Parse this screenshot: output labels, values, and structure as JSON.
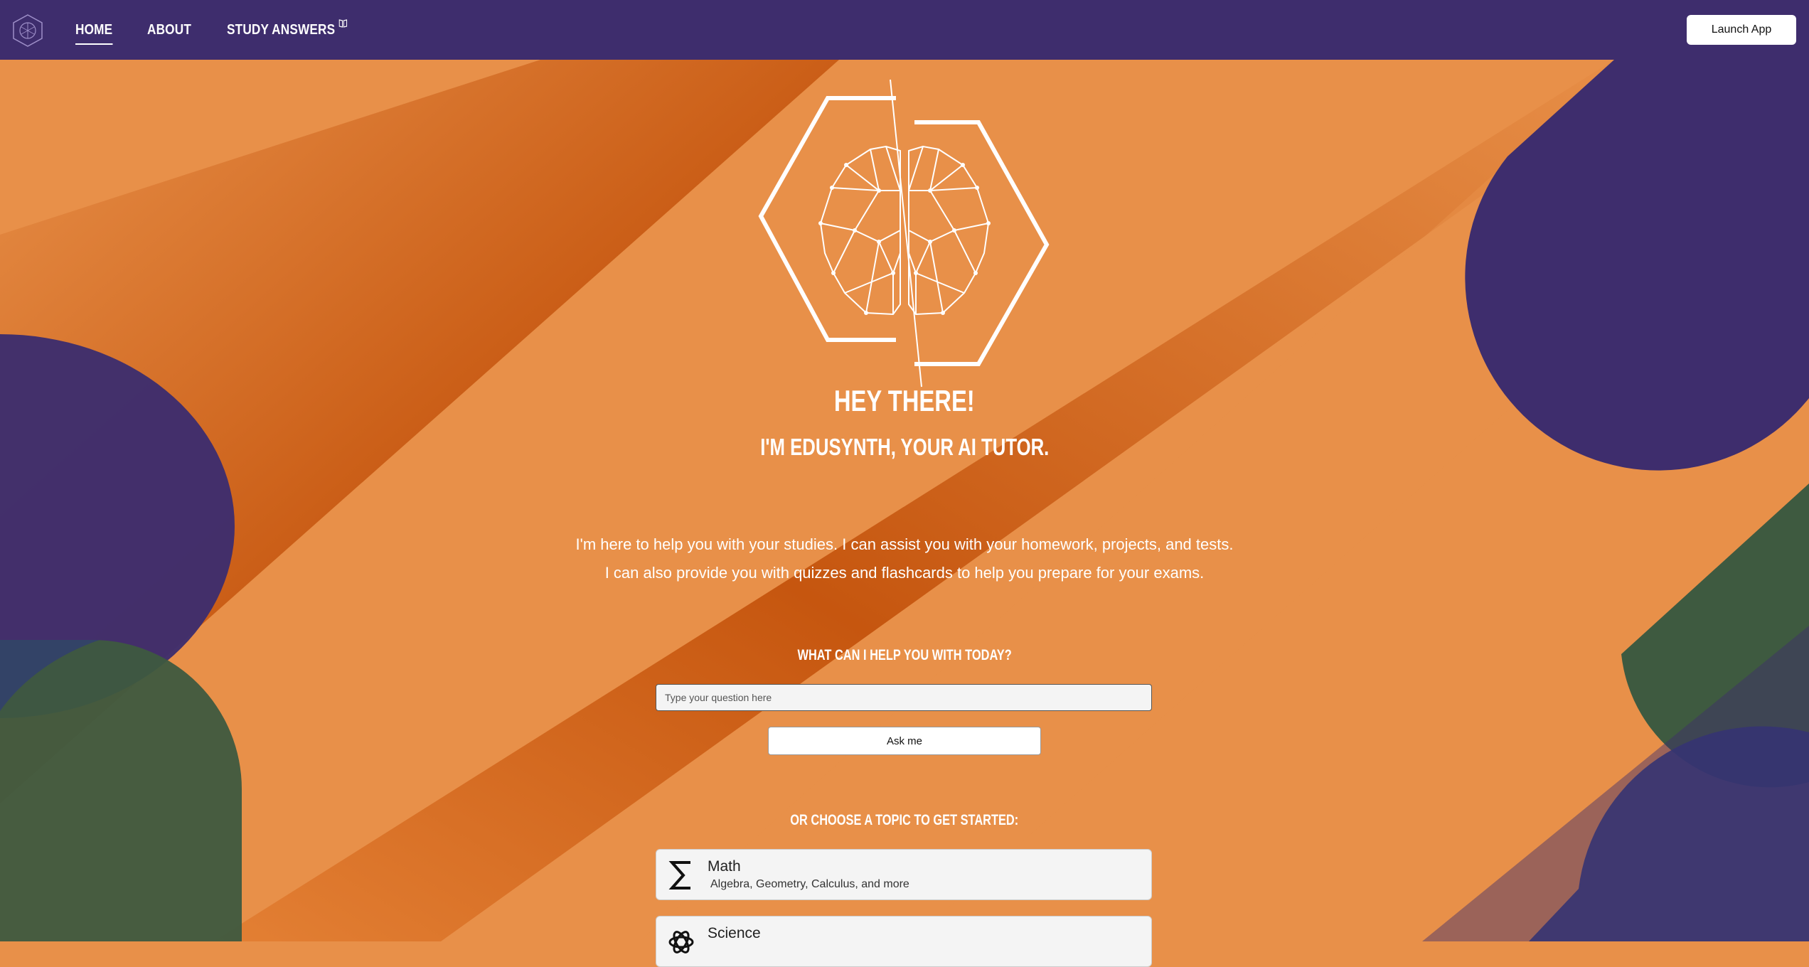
{
  "nav": {
    "links": [
      {
        "label": "Home",
        "active": true
      },
      {
        "label": "About",
        "active": false
      },
      {
        "label": "Study Answers",
        "active": false
      }
    ],
    "launch_label": "Launch App"
  },
  "hero": {
    "title": "Hey there!",
    "subtitle": "I'm EduSynth, your AI tutor.",
    "intro_line1": "I'm here to help you with your studies. I can assist you with your homework, projects, and tests.",
    "intro_line2": "I can also provide you with quizzes and flashcards to help you prepare for your exams."
  },
  "ask": {
    "label": "What can I help you with today?",
    "placeholder": "Type your question here",
    "button_label": "Ask me"
  },
  "topics": {
    "label": "Or choose a topic to get started:",
    "items": [
      {
        "title": "Math",
        "subtitle": "Algebra, Geometry, Calculus, and more",
        "icon": "sigma-icon"
      },
      {
        "title": "Science",
        "subtitle": "",
        "icon": "atom-icon"
      }
    ]
  },
  "colors": {
    "nav_bg": "#3E2D6D",
    "orange": "#E89049",
    "dark_orange": "#C4530C",
    "purple": "#3E2D6D",
    "green": "#3E5A40",
    "white": "#FFFFFF"
  }
}
